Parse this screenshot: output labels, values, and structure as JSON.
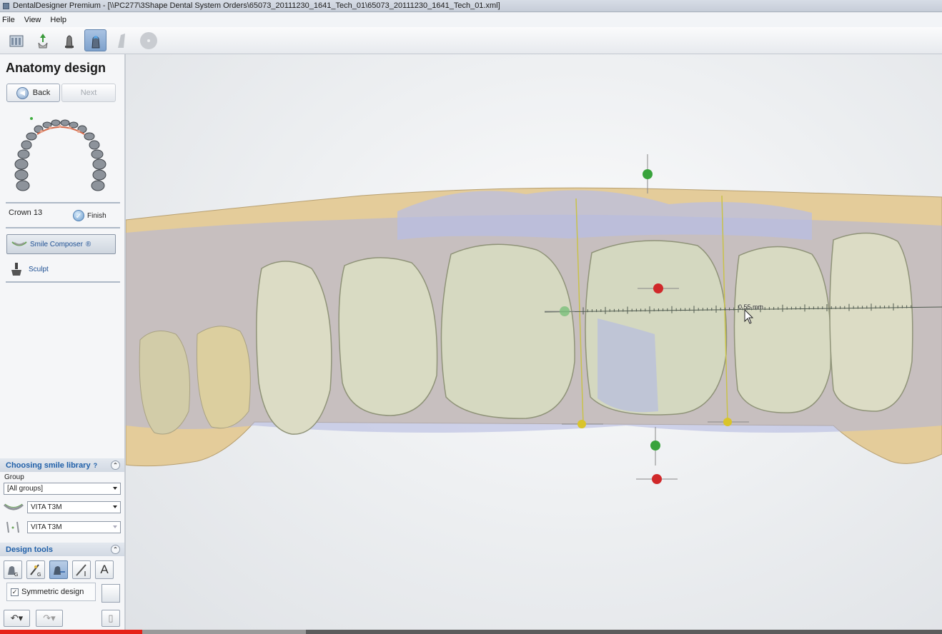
{
  "window": {
    "title": "DentalDesigner Premium - [\\\\PC277\\3Shape Dental System Orders\\65073_20111230_1641_Tech_01\\65073_20111230_1641_Tech_01.xml]"
  },
  "menu": {
    "items": [
      "File",
      "View",
      "Help"
    ]
  },
  "toolbar": {
    "icons": [
      "order-form-icon",
      "scan-icon",
      "prep-die-icon",
      "anatomy-design-icon",
      "disabled-tool-icon",
      "disabled-circle-icon"
    ],
    "active_index": 3
  },
  "sidebar": {
    "heading": "Anatomy design",
    "back_label": "Back",
    "next_label": "Next",
    "crown_label": "Crown 13",
    "finish_label": "Finish",
    "smile_composer_label": "Smile Composer",
    "smile_composer_marker": "®",
    "sculpt_label": "Sculpt"
  },
  "smile_library": {
    "title": "Choosing smile library",
    "help_mark": "?",
    "group_label": "Group",
    "group_value": "[All groups]",
    "library_value_1": "VITA T3M",
    "library_value_2": "VITA T3M"
  },
  "design_tools": {
    "title": "Design tools",
    "tool_letter": "A",
    "symmetric_label": "Symmetric design",
    "symmetric_checked": true
  },
  "viewport": {
    "measurement": "0.55 mm"
  },
  "video_progress": {
    "played_fraction": 0.151,
    "buffered_fraction": 0.325,
    "played_color": "#e62117"
  },
  "colors": {
    "accent": "#1f5fa8",
    "gingiva": "#e7cf9a",
    "tooth": "#d8dbc3",
    "overlay": "#aeb4df"
  }
}
